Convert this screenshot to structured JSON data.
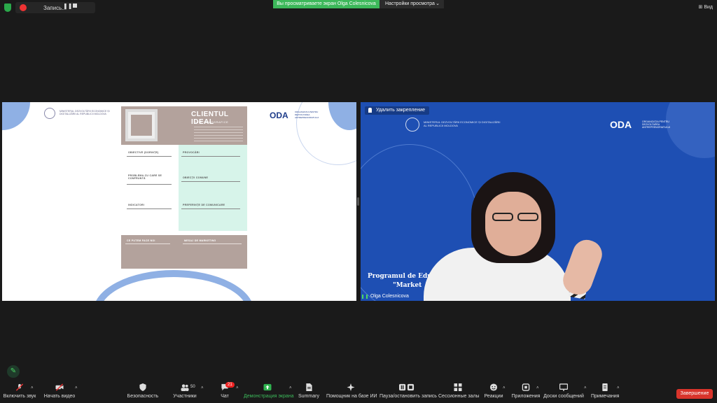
{
  "top": {
    "recording_label": "Запись...",
    "viewing_banner": "Вы просматриваете экран Olga Colesnicova",
    "view_settings_label": "Настройки просмотра",
    "view_button": "Вид"
  },
  "left_slide": {
    "ministry_text": "MINISTERUL DEZVOLTĂRII ECONOMICE ȘI DIGITALIZĂRII AL REPUBLICII MOLDOVA",
    "oda_logo": "ODA",
    "oda_sub": "ORGANIZAȚIA PENTRU DEZVOLTAREA ANTREPRENORIATULUI",
    "canvas": {
      "title": "CLIENTUL IDEAL",
      "demographics": "DATE DEMOGRAFICE",
      "objectives": "OBIECTIVE (DORINȚE)",
      "challenges": "PROVOCĂRI",
      "problem": "PROBLEMA CU CARE SE CONFRUNTĂ",
      "common_objections": "OBIECȚII COMUNE",
      "indicators": "INDICATORI",
      "communication": "PREFERINȚE DE COMUNICARE",
      "what_we_can_do": "CE PUTEM FACE NOI",
      "marketing_message": "MESAJ DE MARKETING"
    }
  },
  "right_pane": {
    "unpin_label": "Удалить закрепление",
    "ministry_text": "MINISTERUL DEZVOLTĂRII ECONOMICE ȘI DIGITALIZĂRII AL REPUBLICII MOLDOVA",
    "oda_logo": "ODA",
    "oda_sub": "ORGANIZAȚIA PENTRU DEZVOLTAREA ANTREPRENORIATULUI",
    "program_title": "Programul de Educ",
    "program_sub": "\"Market",
    "participant_name": "Olga Colesnicova"
  },
  "toolbar": {
    "unmute": "Включить звук",
    "start_video": "Начать видео",
    "security": "Безопасность",
    "participants": "Участники",
    "participants_count": "50",
    "chat": "Чат",
    "chat_badge": "21",
    "share_screen": "Демонстрация экрана",
    "summary": "Summary",
    "ai_assistant": "Помощник на базе ИИ",
    "pause_recording": "Пауза/остановить запись",
    "breakout": "Сессионные залы",
    "reactions": "Реакции",
    "apps": "Приложения",
    "whiteboards": "Доски сообщений",
    "notes": "Примечания",
    "end": "Завершение"
  },
  "colors": {
    "share_green": "#3cb85a",
    "end_red": "#d9342b",
    "slide_blue": "#1e4fb3"
  }
}
